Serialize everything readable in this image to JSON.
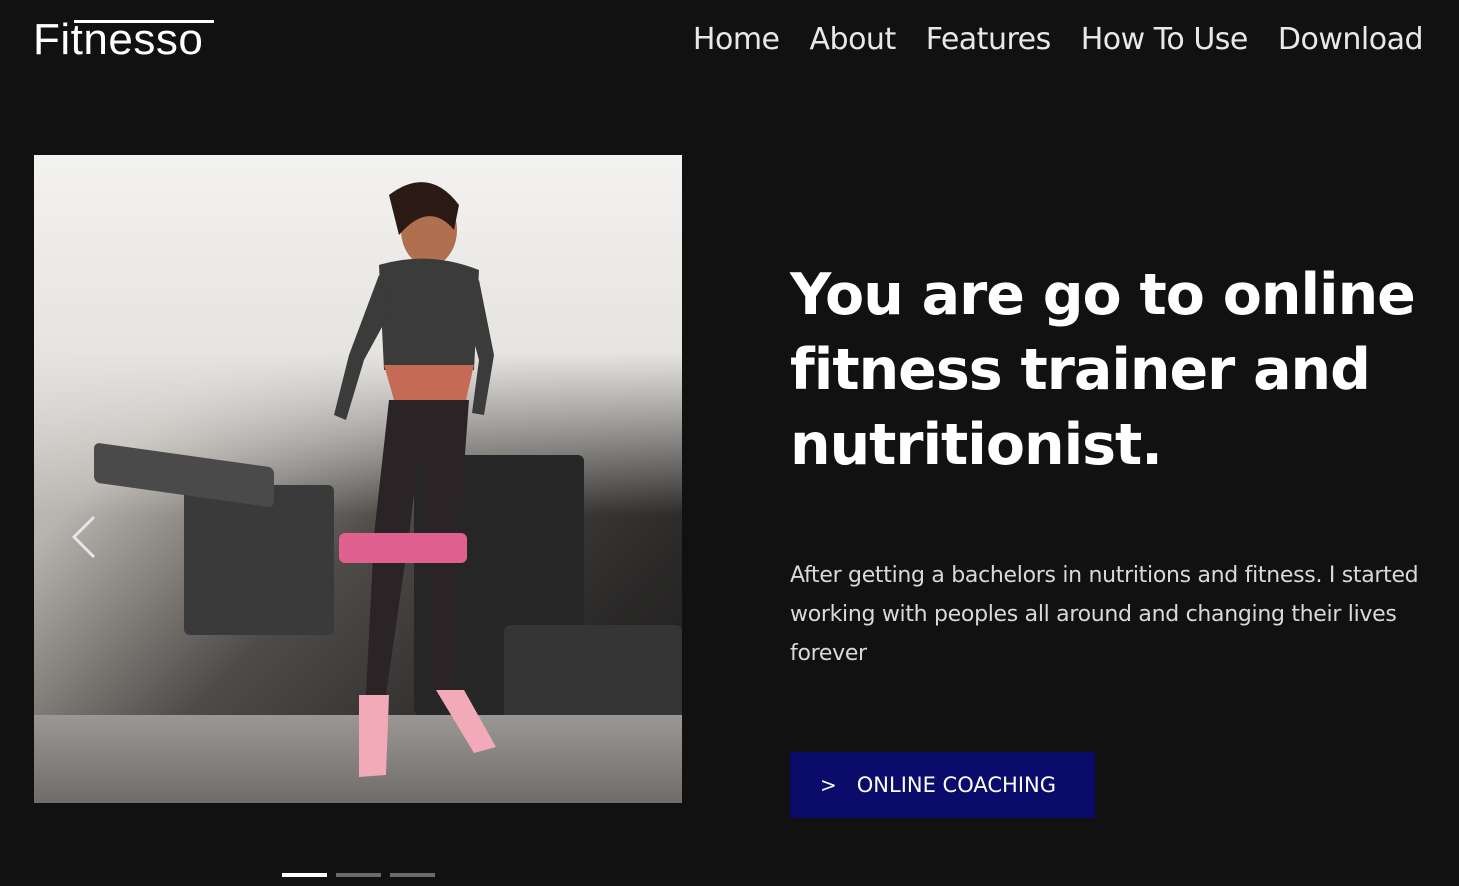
{
  "brand": {
    "logo_text": "Fitnesso"
  },
  "nav": {
    "items": [
      {
        "label": "Home"
      },
      {
        "label": "About"
      },
      {
        "label": "Features"
      },
      {
        "label": "How To Use"
      },
      {
        "label": "Download"
      }
    ]
  },
  "hero": {
    "title": "You are go to online fitness trainer and nutritionist.",
    "description": "After getting a bachelors in nutritions and fitness. I started working with peoples all around and changing their lives forever",
    "cta": {
      "icon": ">",
      "label": "ONLINE COACHING"
    }
  },
  "carousel": {
    "prev_icon": "chevron-left-icon",
    "slide_count": 3,
    "active_index": 0
  },
  "colors": {
    "background": "#111111",
    "cta_background": "#0b0b6b",
    "indicator_active": "#ffffff",
    "indicator_inactive": "#6b6b6b"
  }
}
